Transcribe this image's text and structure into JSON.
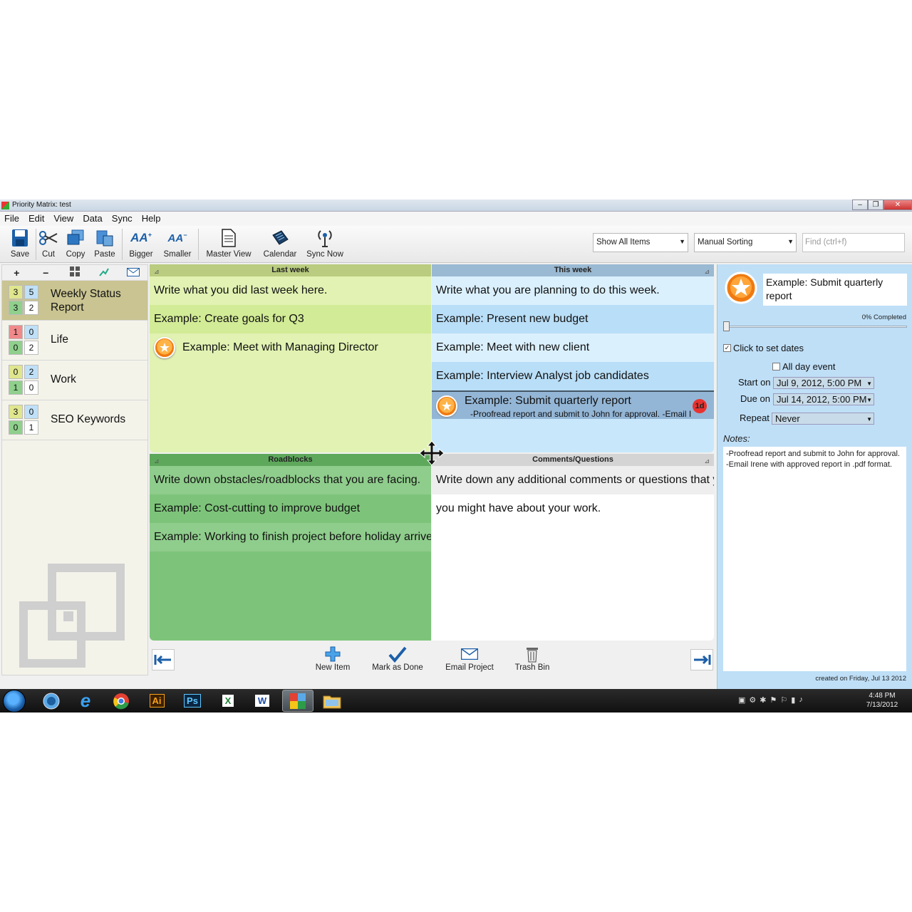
{
  "window": {
    "title": "Priority Matrix: test"
  },
  "menu": [
    "File",
    "Edit",
    "View",
    "Data",
    "Sync",
    "Help"
  ],
  "toolbar": {
    "save": "Save",
    "cut": "Cut",
    "copy": "Copy",
    "paste": "Paste",
    "bigger": "Bigger",
    "smaller": "Smaller",
    "master_view": "Master View",
    "calendar": "Calendar",
    "sync_now": "Sync Now",
    "filter_value": "Show All Items",
    "sort_value": "Manual Sorting",
    "find_placeholder": "Find (ctrl+f)"
  },
  "sidebar": {
    "tools": [
      "+",
      "−"
    ],
    "projects": [
      {
        "name": "Weekly Status Report",
        "counts": [
          "3",
          "5",
          "3",
          "2"
        ]
      },
      {
        "name": "Life",
        "counts": [
          "1",
          "0",
          "0",
          "2"
        ]
      },
      {
        "name": "Work",
        "counts": [
          "0",
          "2",
          "1",
          "0"
        ]
      },
      {
        "name": "SEO Keywords",
        "counts": [
          "3",
          "0",
          "0",
          "1"
        ]
      }
    ]
  },
  "quadrants": {
    "q1": {
      "title": "Last week",
      "items": [
        "Write what you did last week here.",
        "Example: Create goals for Q3",
        "Example: Meet with Managing Director"
      ]
    },
    "q2": {
      "title": "This week",
      "items": [
        "Write what you are planning to do this week.",
        "Example: Present new budget",
        "Example: Meet with new client",
        "Example: Interview Analyst job candidates"
      ],
      "selected_title": "Example: Submit quarterly report",
      "selected_sub": "-Proofread report and submit to John for approval. -Email I",
      "selected_badge": "1d"
    },
    "q3": {
      "title": "Roadblocks",
      "items": [
        "Write down obstacles/roadblocks that you are facing.",
        "Example: Cost-cutting to improve budget",
        "Example: Working to finish project before holiday arrive"
      ]
    },
    "q4": {
      "title": "Comments/Questions",
      "items": [
        "Write down any additional comments or questions that y",
        "you might have about your work."
      ]
    }
  },
  "bottom": {
    "new_item": "New Item",
    "mark_done": "Mark as Done",
    "email_project": "Email Project",
    "trash_bin": "Trash Bin"
  },
  "detail": {
    "title": "Example: Submit quarterly report",
    "progress_label": "0% Completed",
    "progress": 0,
    "set_dates": "Click to set dates",
    "all_day": "All day event",
    "start_label": "Start on",
    "start_value": "Jul 9, 2012, 5:00 PM",
    "due_label": "Due on",
    "due_value": "Jul 14, 2012, 5:00 PM",
    "repeat_label": "Repeat",
    "repeat_value": "Never",
    "notes_label": "Notes:",
    "notes": "-Proofread report and submit to John for approval.\n-Email Irene with approved report in .pdf format.",
    "created": "created on Friday, Jul 13 2012"
  },
  "taskbar": {
    "time": "4:48 PM",
    "date": "7/13/2012",
    "apps": [
      "Ai",
      "Ps",
      "X",
      "W"
    ]
  },
  "colors": {
    "q1": "#e1f2b2",
    "q2": "#c8e7fb",
    "q3": "#7dc47a",
    "q4": "#ffffff",
    "detail": "#bfdff7"
  }
}
